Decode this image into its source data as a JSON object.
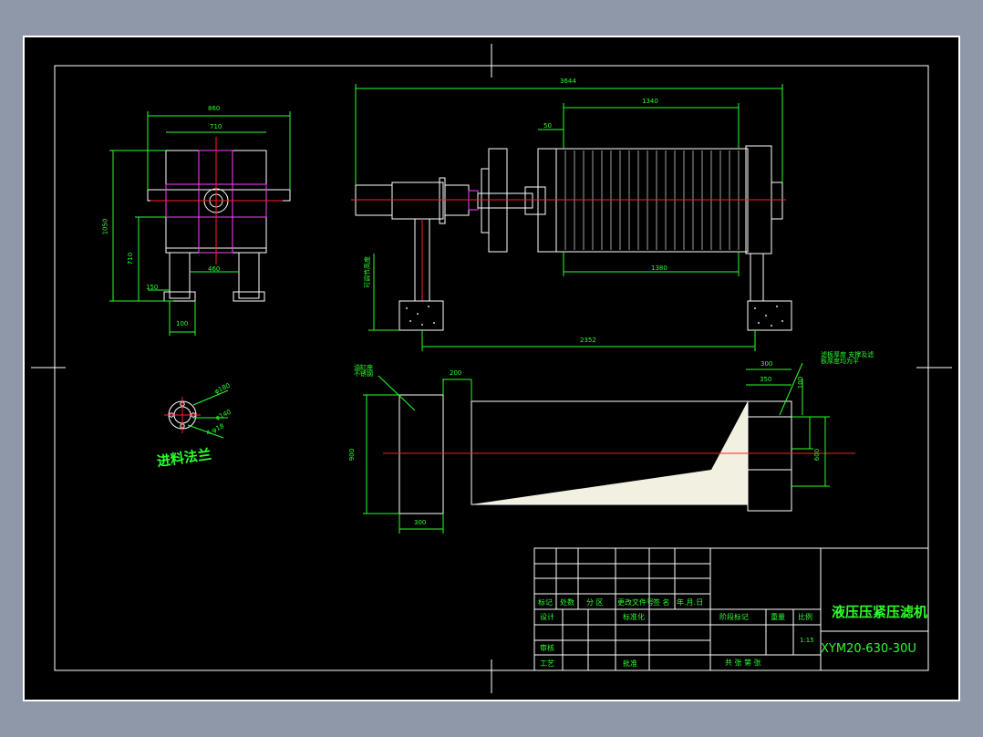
{
  "colors": {
    "background": "#8e98a9",
    "sheet": "#000000",
    "frame": "#ffffff",
    "dimension": "#2aff2a",
    "centerline": "#ff2020",
    "highlight": "#ff40ff",
    "shaded": "#f2f0e0"
  },
  "front_view": {
    "dim_overall_width": "860",
    "dim_inner_width": "710",
    "dim_height": "1050",
    "dim_mid_height": "710",
    "dim_foot_spacing": "460",
    "dim_foot_offset": "150",
    "dim_foot_width": "100"
  },
  "side_view": {
    "dim_total_length": "3644",
    "dim_plate_pack": "1340",
    "dim_head_gap": "50",
    "dim_plate_pack_lower": "1380",
    "dim_foot_spacing": "2352",
    "dim_vertical_note": "可调节高度"
  },
  "plan_view": {
    "note_left": "油缸座 不锈钢",
    "dim_left_gap": "200",
    "dim_left_height": "900",
    "dim_left_width": "300",
    "dim_right_top": "300",
    "dim_right_sub": "350",
    "dim_right_small": "100",
    "dim_right_height": "600",
    "note_right": "滤板厚度 支撑及滤板厚度均为平"
  },
  "flange": {
    "label": "进料法兰",
    "dim_a": "φ180",
    "dim_b": "φ140",
    "dim_c": "4-φ18"
  },
  "title_block": {
    "product_name": "液压压紧压滤机",
    "model": "XYM20-630-30U",
    "row_labels": [
      "标记",
      "处数",
      "分 区",
      "更改文件号",
      "签 名",
      "年.月.日"
    ],
    "design": "设计",
    "standard": "标准化",
    "review": "审核",
    "process": "工艺",
    "approve": "批准",
    "stage_mark": "阶段标记",
    "weight": "重量",
    "scale": "比例",
    "scale_value": "1:15",
    "sheets": "共 张 第 张"
  }
}
